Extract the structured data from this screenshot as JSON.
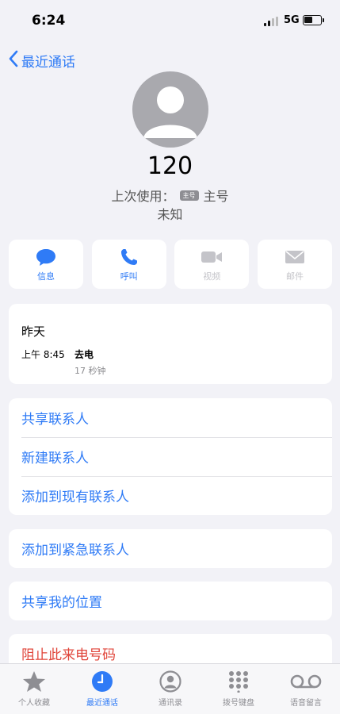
{
  "status": {
    "time": "6:24",
    "network": "5G"
  },
  "nav": {
    "back_label": "最近通话"
  },
  "contact": {
    "number": "120",
    "last_used_label": "上次使用：",
    "sim_badge": "主号",
    "sim_label": "主号",
    "status": "未知"
  },
  "actions": [
    {
      "label": "信息",
      "icon": "message-icon",
      "enabled": true
    },
    {
      "label": "呼叫",
      "icon": "phone-icon",
      "enabled": true
    },
    {
      "label": "视频",
      "icon": "video-icon",
      "enabled": false
    },
    {
      "label": "邮件",
      "icon": "mail-icon",
      "enabled": false
    }
  ],
  "recent": {
    "day": "昨天",
    "time": "上午 8:45",
    "type": "去电",
    "duration": "17 秒钟"
  },
  "options": {
    "share_contact": "共享联系人",
    "new_contact": "新建联系人",
    "add_existing": "添加到现有联系人",
    "add_emergency": "添加到紧急联系人",
    "share_location": "共享我的位置",
    "block": "阻止此来电号码"
  },
  "tabs": [
    {
      "label": "个人收藏",
      "icon": "star-icon",
      "active": false
    },
    {
      "label": "最近通话",
      "icon": "clock-icon",
      "active": true
    },
    {
      "label": "通讯录",
      "icon": "contacts-icon",
      "active": false
    },
    {
      "label": "拨号键盘",
      "icon": "keypad-icon",
      "active": false
    },
    {
      "label": "语音留言",
      "icon": "voicemail-icon",
      "active": false
    }
  ],
  "colors": {
    "accent": "#2f7bf6",
    "danger": "#e0453a",
    "background": "#f2f2f7"
  }
}
